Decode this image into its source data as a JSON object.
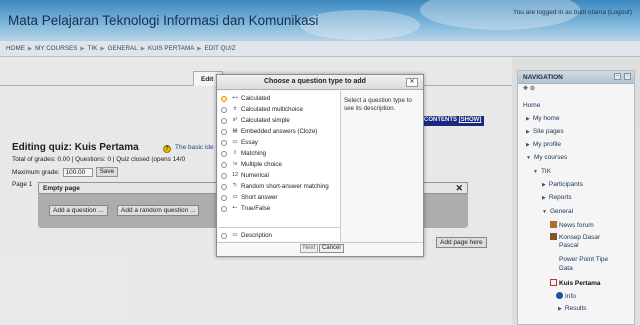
{
  "header": {
    "site_title": "Mata Pelajaran Teknologi Informasi dan Komunikasi",
    "login_prefix": "You are logged in as",
    "user_name": "budi utama",
    "logout_label": "(Logout)"
  },
  "breadcrumb": [
    "HOME",
    "MY COURSES",
    "TIK",
    "GENERAL",
    "KUIS PERTAMA",
    "EDIT QUIZ"
  ],
  "main": {
    "tab_edit": "Edit",
    "contents_label": "CONTENTS",
    "contents_show": "[SHOW]",
    "quiz_title": "Editing quiz: Kuis Pertama",
    "basic_ideas": "The basic ide",
    "totals": "Total of grades: 0.00 | Questions: 0 | Quiz closed (opens 14/0",
    "max_grade_label": "Maximum grade:",
    "max_grade_value": "100.00",
    "save_label": "Save",
    "page_label": "Page 1",
    "page_box_title": "Empty page",
    "page_box_close": "✕",
    "add_question": "Add a question ...",
    "add_random_question": "Add a random question ...",
    "add_page_here": "Add page here"
  },
  "navigation": {
    "title": "NAVIGATION",
    "home": "Home",
    "my_home": "My home",
    "site_pages": "Site pages",
    "my_profile": "My profile",
    "my_courses": "My courses",
    "tik": "TIK",
    "participants": "Participants",
    "reports": "Reports",
    "general": "General",
    "news_forum": "News forum",
    "konsep_1": "Konsep Dasar",
    "konsep_2": "Pascal",
    "ppt_1": "Power Point Tipe",
    "ppt_2": "Data",
    "kuis_pertama": "Kuis Pertama",
    "info": "Info",
    "results": "Results"
  },
  "dialog": {
    "title": "Choose a question type to add",
    "close": "✕",
    "question_types": [
      {
        "label": "Calculated",
        "icon": "calculated-icon"
      },
      {
        "label": "Calculated multichoice",
        "icon": "calculated-multichoice-icon"
      },
      {
        "label": "Calculated simple",
        "icon": "calculated-simple-icon"
      },
      {
        "label": "Embedded answers (Cloze)",
        "icon": "cloze-icon"
      },
      {
        "label": "Essay",
        "icon": "essay-icon"
      },
      {
        "label": "Matching",
        "icon": "matching-icon"
      },
      {
        "label": "Multiple choice",
        "icon": "multiple-choice-icon"
      },
      {
        "label": "Numerical",
        "icon": "numerical-icon"
      },
      {
        "label": "Random short-answer matching",
        "icon": "random-short-answer-icon"
      },
      {
        "label": "Short answer",
        "icon": "short-answer-icon"
      },
      {
        "label": "True/False",
        "icon": "true-false-icon"
      },
      {
        "label": "Description",
        "icon": "description-icon"
      }
    ],
    "description": "Select a question type to see its description.",
    "next_label": "Next",
    "cancel_label": "Cancel"
  }
}
